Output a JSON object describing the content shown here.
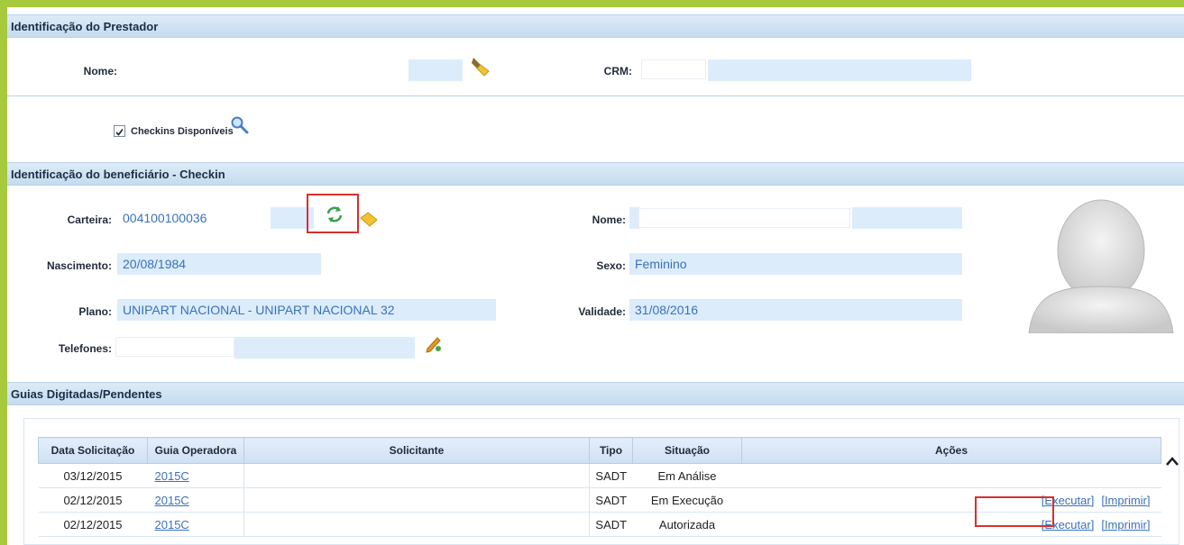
{
  "prestador": {
    "header": "Identificação do Prestador",
    "nome_label": "Nome:",
    "crm_label": "CRM:",
    "checkins_label": "Checkins Disponíveis",
    "checkins_checked": true
  },
  "beneficiario": {
    "header": "Identificação do beneficiário - Checkin",
    "carteira_label": "Carteira:",
    "carteira_value": "004100100036",
    "nome_label": "Nome:",
    "nascimento_label": "Nascimento:",
    "nascimento_value": "20/08/1984",
    "sexo_label": "Sexo:",
    "sexo_value": "Feminino",
    "plano_label": "Plano:",
    "plano_value": "UNIPART NACIONAL - UNIPART NACIONAL 32",
    "validade_label": "Validade:",
    "validade_value": "31/08/2016",
    "telefones_label": "Telefones:"
  },
  "guias": {
    "header": "Guias Digitadas/Pendentes",
    "columns": [
      "Data Solicitação",
      "Guia Operadora",
      "Solicitante",
      "Tipo",
      "Situação",
      "Ações"
    ],
    "rows": [
      {
        "data": "03/12/2015",
        "guia": "2015C",
        "solicitante": "",
        "tipo": "SADT",
        "situacao": "Em Análise",
        "executar": "",
        "imprimir": ""
      },
      {
        "data": "02/12/2015",
        "guia": "2015C",
        "solicitante": "",
        "tipo": "SADT",
        "situacao": "Em Execução",
        "executar": "[Executar]",
        "imprimir": "[Imprimir]"
      },
      {
        "data": "02/12/2015",
        "guia": "2015C",
        "solicitante": "",
        "tipo": "SADT",
        "situacao": "Autorizada",
        "executar": "[Executar]",
        "imprimir": "[Imprimir]"
      }
    ]
  },
  "colors": {
    "accent_green": "#a7c93c",
    "field_bg": "#dcecfb",
    "link": "#3a72b8",
    "highlight": "#d4312f"
  },
  "icons": [
    "eraser-icon",
    "search-icon",
    "refresh-icon",
    "edit-pencil-icon",
    "avatar-placeholder",
    "scroll-up-icon"
  ]
}
